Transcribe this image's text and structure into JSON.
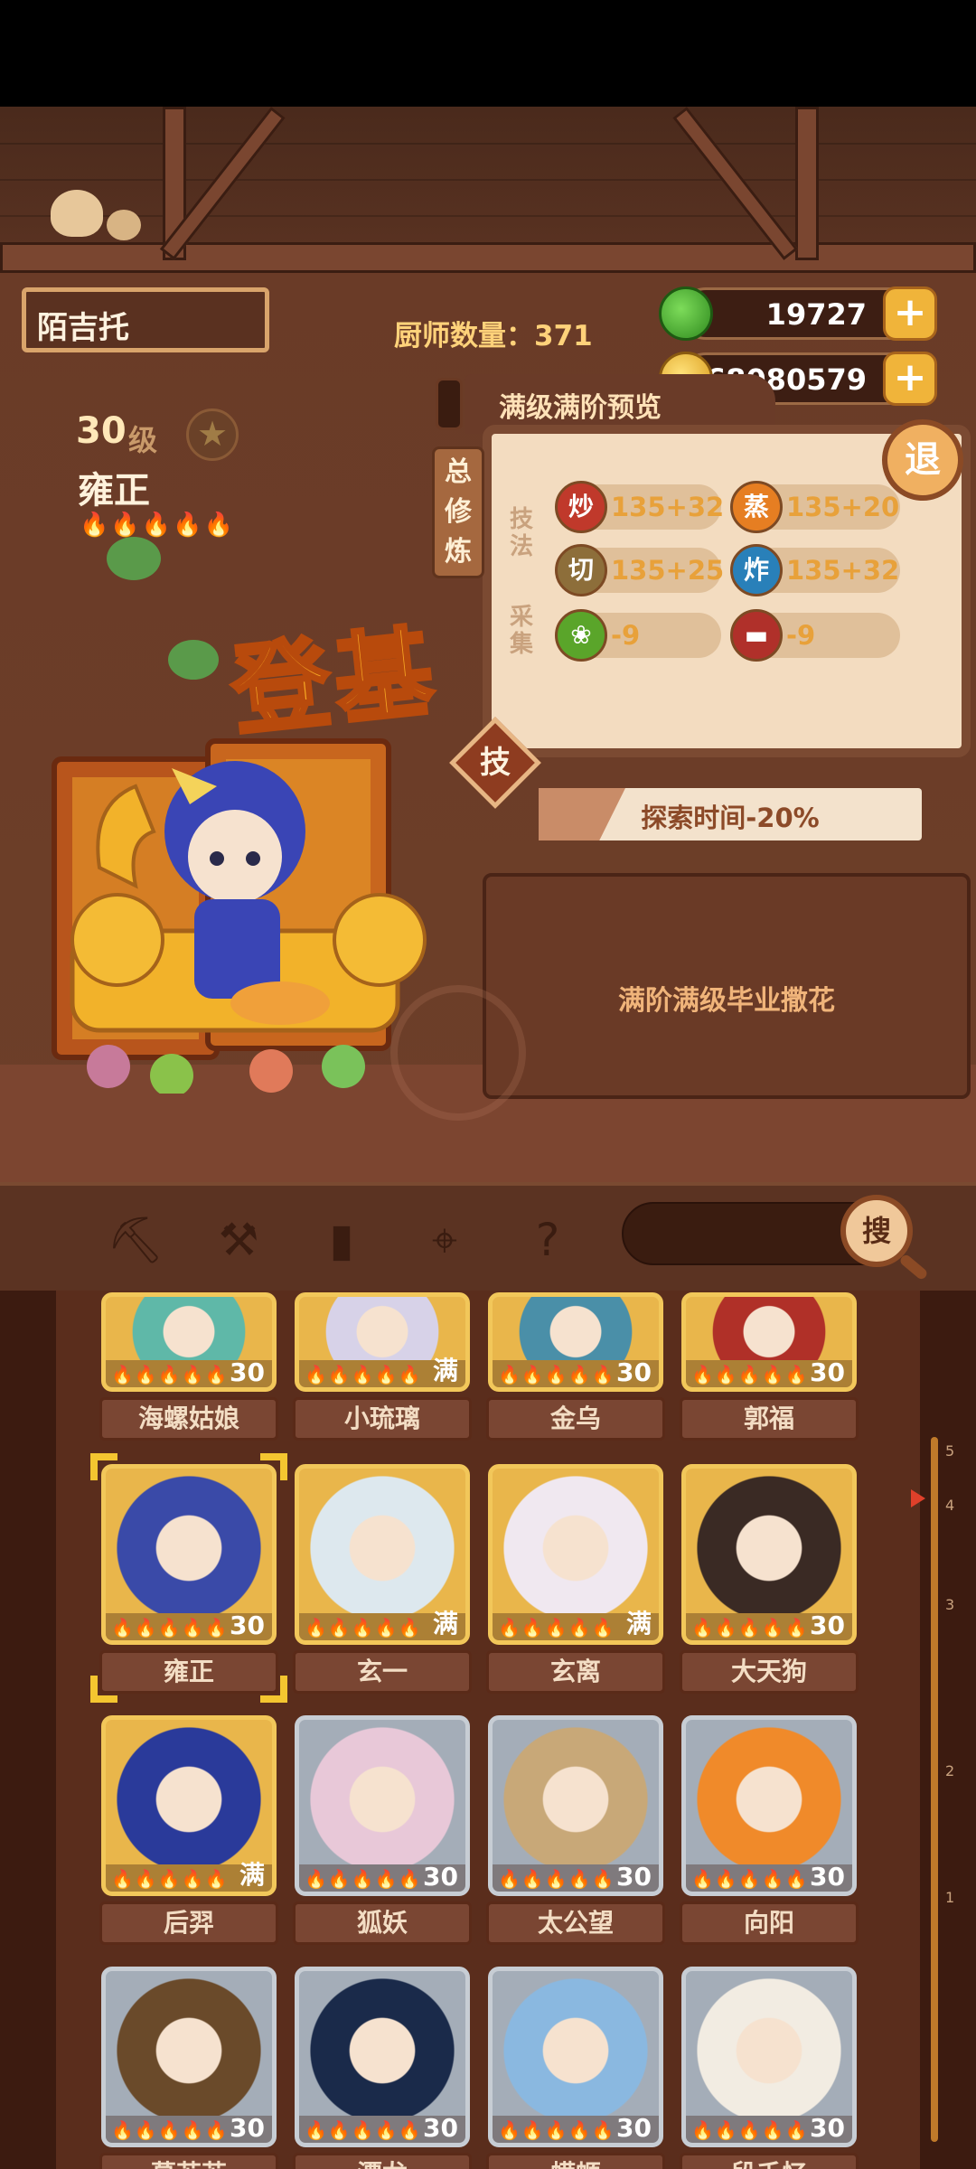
{
  "header": {
    "player_name": "陌吉托",
    "chef_count_label": "厨师数量：371",
    "jade_amount": "19727",
    "coin_amount": "68080579",
    "plus_symbol": "+"
  },
  "chef": {
    "level": "30",
    "level_unit": "级",
    "name": "雍正",
    "flames": "🔥🔥🔥🔥🔥",
    "title_art": "登基"
  },
  "skill_panel": {
    "tab_label": "满级满阶预览",
    "side_label": "总修炼",
    "technique_label": "技法",
    "gather_label": "采集",
    "retreat_label": "退",
    "skill_button_label": "技",
    "skills": [
      {
        "icon": "炒",
        "value": "135+32",
        "color": "#c0392b"
      },
      {
        "icon": "蒸",
        "value": "135+20",
        "color": "#e67e22"
      },
      {
        "icon": "切",
        "value": "135+25",
        "color": "#8d6e3a"
      },
      {
        "icon": "炸",
        "value": "135+32",
        "color": "#2980b9"
      }
    ],
    "gather": [
      {
        "icon": "菜",
        "value": "-9",
        "color": "#5aa52a"
      },
      {
        "icon": "肉",
        "value": "-9",
        "color": "#b0302a"
      }
    ],
    "explore_bonus": "探索时间-20%",
    "description": "满阶满级毕业撒花"
  },
  "toolbar": {
    "search_label": "搜",
    "icons": [
      "shovel-icon",
      "spade-icon",
      "jar-icon",
      "location-pin-icon",
      "map-help-icon"
    ]
  },
  "roster": {
    "rows": [
      [
        {
          "name": "海螺姑娘",
          "level": "30",
          "tier": "gold",
          "hue": "#5fb8a8"
        },
        {
          "name": "小琉璃",
          "level": "满",
          "tier": "gold",
          "hue": "#d7d2e8"
        },
        {
          "name": "金乌",
          "level": "30",
          "tier": "gold",
          "hue": "#4a8fa8"
        },
        {
          "name": "郭福",
          "level": "30",
          "tier": "gold",
          "hue": "#b03028"
        }
      ],
      [
        {
          "name": "雍正",
          "level": "30",
          "tier": "gold",
          "hue": "#3a4aa8",
          "selected": true
        },
        {
          "name": "玄一",
          "level": "满",
          "tier": "gold",
          "hue": "#dde8ee"
        },
        {
          "name": "玄离",
          "level": "满",
          "tier": "gold",
          "hue": "#f0e8f0"
        },
        {
          "name": "大天狗",
          "level": "30",
          "tier": "gold",
          "hue": "#3a2a24"
        }
      ],
      [
        {
          "name": "后羿",
          "level": "满",
          "tier": "gold",
          "hue": "#2a3a9a"
        },
        {
          "name": "狐妖",
          "level": "30",
          "tier": "silver",
          "hue": "#e8c8d8"
        },
        {
          "name": "太公望",
          "level": "30",
          "tier": "silver",
          "hue": "#c8a878"
        },
        {
          "name": "向阳",
          "level": "30",
          "tier": "silver",
          "hue": "#f08a2a"
        }
      ],
      [
        {
          "name": "慕苏苏",
          "level": "30",
          "tier": "silver",
          "hue": "#6a4a2a"
        },
        {
          "name": "潭龙",
          "level": "30",
          "tier": "silver",
          "hue": "#1a2a4a"
        },
        {
          "name": "蝾螈",
          "level": "30",
          "tier": "silver",
          "hue": "#8ab8e0"
        },
        {
          "name": "段千忆",
          "level": "30",
          "tier": "silver",
          "hue": "#f2ece2"
        }
      ]
    ],
    "card_flames": "🔥🔥🔥🔥🔥",
    "scroll_marks": [
      "5",
      "4",
      "3",
      "2",
      "1"
    ]
  }
}
